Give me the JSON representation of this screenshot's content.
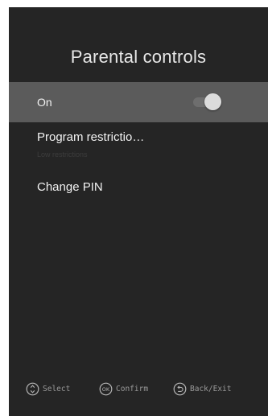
{
  "screen": {
    "title": "Parental controls"
  },
  "menu": {
    "items": [
      {
        "label": "On",
        "toggle": {
          "state": "on"
        }
      },
      {
        "label": "Program restrictio…",
        "sublabel": "Low restrictions"
      },
      {
        "label": "Change PIN"
      }
    ]
  },
  "footer": {
    "hints": [
      {
        "icon": "up-down-arrows-icon",
        "label": "Select"
      },
      {
        "icon": "ok-button-icon",
        "label": "Confirm",
        "icon_text": "OK"
      },
      {
        "icon": "back-arrow-icon",
        "label": "Back/Exit"
      }
    ]
  },
  "colors": {
    "background": "#252525",
    "selected_row": "#5b5b5b",
    "text": "#ededed",
    "hint_text": "#9a9a9a"
  }
}
